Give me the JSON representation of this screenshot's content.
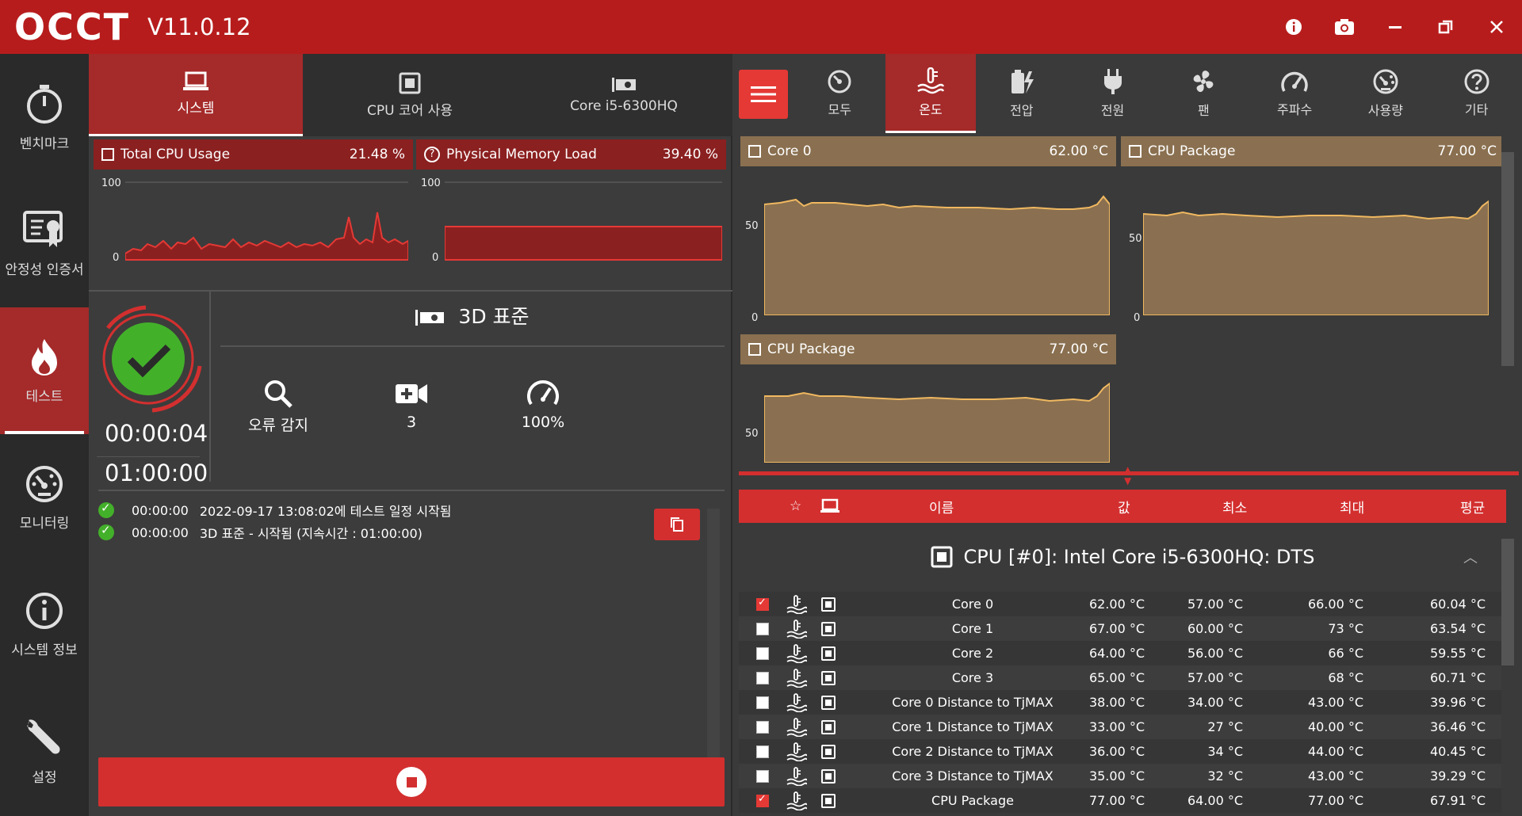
{
  "app": {
    "logo": "OCCT",
    "version": "V11.0.12"
  },
  "window_controls": [
    "info-icon",
    "camera-icon",
    "minimize-icon",
    "restore-icon",
    "close-icon"
  ],
  "sidebar": [
    {
      "label": "벤치마크",
      "icon": "stopwatch-icon"
    },
    {
      "label": "안정성 인증서",
      "icon": "certificate-icon"
    },
    {
      "label": "테스트",
      "icon": "flame-icon",
      "active": true
    },
    {
      "label": "모니터링",
      "icon": "gauge-icon"
    },
    {
      "label": "시스템 정보",
      "icon": "info-icon"
    },
    {
      "label": "설정",
      "icon": "wrench-icon"
    }
  ],
  "mid_tabs": [
    {
      "label": "시스템",
      "icon": "laptop-icon",
      "active": true
    },
    {
      "label": "CPU 코어 사용",
      "icon": "cpu-icon"
    },
    {
      "label": "Core i5-6300HQ",
      "icon": "gpu-icon"
    }
  ],
  "mini_charts": [
    {
      "title": "Total CPU Usage",
      "value": "21.48 %",
      "ymax": "100",
      "ymin": "0"
    },
    {
      "title": "Physical Memory Load",
      "value": "39.40 %",
      "ymax": "100",
      "ymin": "0"
    }
  ],
  "test": {
    "title": "3D 표준",
    "elapsed": "00:00:04",
    "duration": "01:00:00",
    "stats": [
      {
        "label": "오류 감지",
        "icon": "search-icon"
      },
      {
        "label": "3",
        "icon": "camera-plus-icon"
      },
      {
        "label": "100%",
        "icon": "speedometer-icon"
      }
    ]
  },
  "log": [
    {
      "time": "00:00:00",
      "text": "2022-09-17 13:08:02에 테스트 일정 시작됨"
    },
    {
      "time": "00:00:00",
      "text": "3D 표준 - 시작됨 (지속시간 : 01:00:00)"
    }
  ],
  "right_tabs": [
    {
      "label": "모두",
      "icon": "all-icon"
    },
    {
      "label": "온도",
      "icon": "thermometer-icon",
      "active": true
    },
    {
      "label": "전압",
      "icon": "voltage-icon"
    },
    {
      "label": "전원",
      "icon": "plug-icon"
    },
    {
      "label": "팬",
      "icon": "fan-icon"
    },
    {
      "label": "주파수",
      "icon": "frequency-icon"
    },
    {
      "label": "사용량",
      "icon": "usage-icon"
    },
    {
      "label": "기타",
      "icon": "question-icon"
    }
  ],
  "temp_charts": [
    {
      "title": "Core 0",
      "value": "62.00 °C",
      "ymid": "50",
      "ymin": "0"
    },
    {
      "title": "CPU Package",
      "value": "77.00 °C",
      "ymid": "50",
      "ymin": "0"
    },
    {
      "title": "CPU Package",
      "value": "77.00 °C",
      "ymid": "50"
    }
  ],
  "table": {
    "headers": {
      "name": "이름",
      "value": "값",
      "min": "최소",
      "max": "최대",
      "avg": "평균"
    },
    "group": "CPU [#0]: Intel Core i5-6300HQ: DTS",
    "rows": [
      {
        "checked": true,
        "name": "Core 0",
        "value": "62.00 °C",
        "min": "57.00 °C",
        "max": "66.00 °C",
        "avg": "60.04 °C"
      },
      {
        "checked": false,
        "name": "Core 1",
        "value": "67.00 °C",
        "min": "60.00 °C",
        "max": "73 °C",
        "avg": "63.54 °C"
      },
      {
        "checked": false,
        "name": "Core 2",
        "value": "64.00 °C",
        "min": "56.00 °C",
        "max": "66 °C",
        "avg": "59.55 °C"
      },
      {
        "checked": false,
        "name": "Core 3",
        "value": "65.00 °C",
        "min": "57.00 °C",
        "max": "68 °C",
        "avg": "60.71 °C"
      },
      {
        "checked": false,
        "name": "Core 0 Distance to TjMAX",
        "value": "38.00 °C",
        "min": "34.00 °C",
        "max": "43.00 °C",
        "avg": "39.96 °C"
      },
      {
        "checked": false,
        "name": "Core 1 Distance to TjMAX",
        "value": "33.00 °C",
        "min": "27 °C",
        "max": "40.00 °C",
        "avg": "36.46 °C"
      },
      {
        "checked": false,
        "name": "Core 2 Distance to TjMAX",
        "value": "36.00 °C",
        "min": "34 °C",
        "max": "44.00 °C",
        "avg": "40.45 °C"
      },
      {
        "checked": false,
        "name": "Core 3 Distance to TjMAX",
        "value": "35.00 °C",
        "min": "32 °C",
        "max": "43.00 °C",
        "avg": "39.29 °C"
      },
      {
        "checked": true,
        "name": "CPU Package",
        "value": "77.00 °C",
        "min": "64.00 °C",
        "max": "77.00 °C",
        "avg": "67.91 °C"
      }
    ]
  },
  "colors": {
    "titlebar": "#b71c1c",
    "accent": "#d32f2f",
    "ok": "#43b02a",
    "temp_fill": "#8a7050"
  }
}
